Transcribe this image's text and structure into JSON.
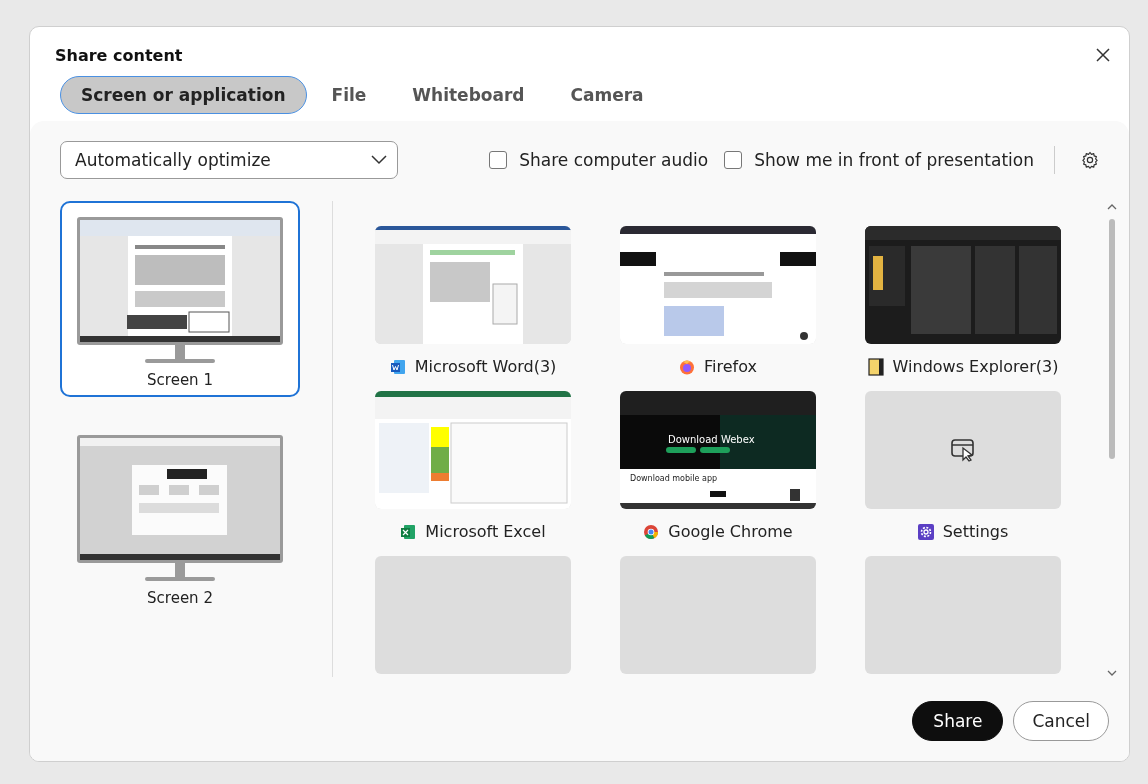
{
  "dialog": {
    "title": "Share content"
  },
  "tabs": [
    {
      "label": "Screen or application",
      "selected": true
    },
    {
      "label": "File",
      "selected": false
    },
    {
      "label": "Whiteboard",
      "selected": false
    },
    {
      "label": "Camera",
      "selected": false
    }
  ],
  "optimize": {
    "value": "Automatically optimize"
  },
  "options": [
    {
      "label": "Share computer audio",
      "checked": false
    },
    {
      "label": "Show me in front of presentation",
      "checked": false
    }
  ],
  "screens": [
    {
      "label": "Screen 1",
      "selected": true,
      "kind": "document"
    },
    {
      "label": "Screen 2",
      "selected": false,
      "kind": "dialog"
    }
  ],
  "apps": [
    {
      "kind": "word",
      "label": "Microsoft Word(3)"
    },
    {
      "kind": "firefox",
      "label": "Firefox"
    },
    {
      "kind": "explorer",
      "label": "Windows Explorer(3)"
    },
    {
      "kind": "excel",
      "label": "Microsoft Excel"
    },
    {
      "kind": "chrome",
      "label": "Google Chrome",
      "texts": [
        "Download Webex",
        "Download mobile app"
      ]
    },
    {
      "kind": "settings",
      "label": "Settings"
    },
    {
      "kind": "blank"
    },
    {
      "kind": "blank"
    },
    {
      "kind": "blank"
    }
  ],
  "buttons": [
    {
      "label": "Share",
      "kind": "primary"
    },
    {
      "label": "Cancel",
      "kind": "secondary"
    }
  ]
}
